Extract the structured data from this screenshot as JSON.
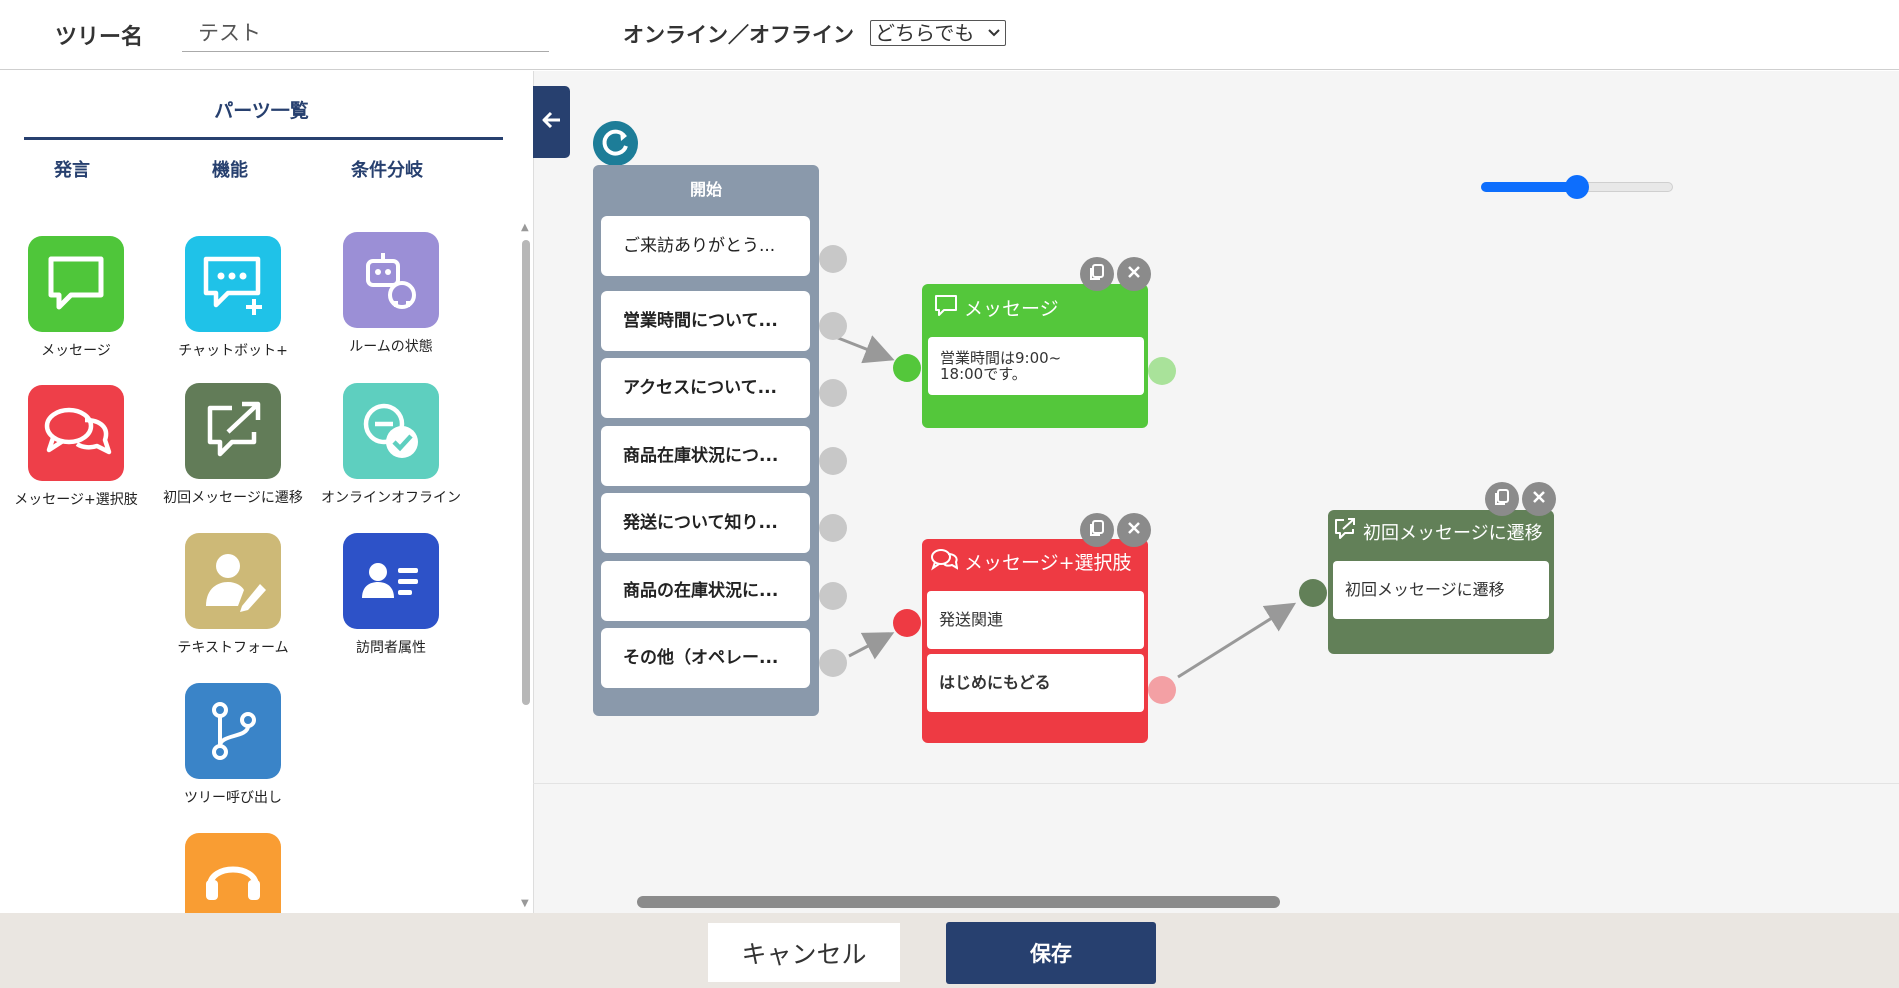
{
  "header": {
    "tree_name_label": "ツリー名",
    "tree_name_value": "テスト",
    "online_label": "オンライン／オフライン",
    "online_select_value": "どちらでも"
  },
  "sidebar": {
    "title": "パーツ一覧",
    "tabs": [
      {
        "label": "発言"
      },
      {
        "label": "機能"
      },
      {
        "label": "条件分岐"
      }
    ],
    "parts": [
      {
        "label": "メッセージ",
        "icon": "message-icon",
        "color": "#4fc63a"
      },
      {
        "label": "チャットボット+",
        "icon": "chatbot-plus-icon",
        "color": "#1fc2e8"
      },
      {
        "label": "ルームの状態",
        "icon": "room-status-robot-icon",
        "color": "#9b8fd6"
      },
      {
        "label": "メッセージ+選択肢",
        "icon": "message-choice-icon",
        "color": "#ee3f49"
      },
      {
        "label": "初回メッセージに遷移",
        "icon": "first-message-transition-icon",
        "color": "#627c58"
      },
      {
        "label": "オンラインオフライン",
        "icon": "online-offline-icon",
        "color": "#5ecfbf"
      },
      {
        "label": "テキストフォーム",
        "icon": "text-form-icon",
        "color": "#cdb977"
      },
      {
        "label": "訪問者属性",
        "icon": "visitor-attribute-icon",
        "color": "#2d52c8"
      },
      {
        "label": "ツリー呼び出し",
        "icon": "tree-call-icon",
        "color": "#3a84c8"
      },
      {
        "label": "",
        "icon": "operator-headset-icon",
        "color": "#f99d33"
      }
    ]
  },
  "canvas": {
    "start_node": {
      "title": "開始",
      "items": [
        "ご来訪ありがとう...",
        "営業時間について...",
        "アクセスについて...",
        "商品在庫状況につ...",
        "発送について知り...",
        "商品の在庫状況に...",
        "その他（オペレー..."
      ]
    },
    "message_node": {
      "title": "メッセージ",
      "body": "営業時間は9:00~\n18:00です。",
      "color": "#54c73b"
    },
    "choice_node": {
      "title": "メッセージ+選択肢",
      "options": [
        "発送関連",
        "はじめにもどる"
      ],
      "color": "#ee3a43"
    },
    "transition_node": {
      "title": "初回メッセージに遷移",
      "body": "初回メッセージに遷移",
      "color": "#628058"
    },
    "zoom": {
      "level_fraction": 0.5
    }
  },
  "footer": {
    "cancel_label": "キャンセル",
    "save_label": "保存"
  },
  "colors": {
    "navy": "#27406f",
    "start_node": "#8a99ab",
    "zoom_accent": "#0d6efd"
  }
}
